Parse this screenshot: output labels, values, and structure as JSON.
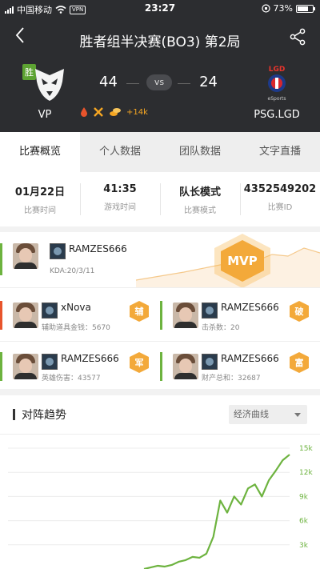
{
  "status_bar": {
    "carrier": "中国移动",
    "vpn": "VPN",
    "time": "23:27",
    "battery": "73%",
    "battery_level": 0.73
  },
  "nav": {
    "title": "胜者组半决赛(BO3) 第2局",
    "back_icon": "back-arrow-icon",
    "share_icon": "share-icon"
  },
  "match": {
    "left_team": {
      "name": "VP",
      "win_tag": "胜"
    },
    "right_team": {
      "name": "PSG.LGD",
      "logo_top": "LGD",
      "logo_bottom": "eSports"
    },
    "score_left": "44",
    "vs": "vs",
    "score_right": "24",
    "gold_advantage": "+14k"
  },
  "tabs": [
    {
      "label": "比赛概览",
      "active": true
    },
    {
      "label": "个人数据",
      "active": false
    },
    {
      "label": "团队数据",
      "active": false
    },
    {
      "label": "文字直播",
      "active": false
    }
  ],
  "info": [
    {
      "value": "01月22日",
      "key": "比赛时间"
    },
    {
      "value": "41:35",
      "key": "游戏时间"
    },
    {
      "value": "队长模式",
      "key": "比赛模式"
    },
    {
      "value": "4352549202",
      "key": "比赛ID"
    }
  ],
  "mvp": {
    "name": "RAMZES666",
    "stat": "KDA:20/3/11",
    "badge": "MVP"
  },
  "awards": [
    {
      "name": "xNova",
      "stat": "辅助道具金钱：5670",
      "badge": "辅",
      "bar": "red"
    },
    {
      "name": "RAMZES666",
      "stat": "击杀数：20",
      "badge": "破",
      "bar": "green"
    },
    {
      "name": "RAMZES666",
      "stat": "英雄伤害：43577",
      "badge": "军",
      "bar": "green"
    },
    {
      "name": "RAMZES666",
      "stat": "财产总和：32687",
      "badge": "富",
      "bar": "green"
    }
  ],
  "trend": {
    "title": "对阵趋势",
    "dropdown": "经济曲线"
  },
  "colors": {
    "accent_green": "#6db33f",
    "accent_red": "#e8542c",
    "badge_orange": "#f3a93a",
    "header_bg": "#2c2d30"
  },
  "chart_data": {
    "type": "line",
    "title": "",
    "xlabel": "",
    "ylabel": "",
    "y_ticks": [
      "15k",
      "12k",
      "9k",
      "6k",
      "3k"
    ],
    "ylim": [
      0,
      15000
    ],
    "series": [
      {
        "values": [
          0,
          200,
          400,
          300,
          500,
          900,
          1100,
          1500,
          1400,
          1900,
          4000,
          8500,
          7000,
          9000,
          8000,
          10000,
          10500,
          9000,
          11000,
          12200,
          13500,
          14200
        ]
      }
    ]
  }
}
